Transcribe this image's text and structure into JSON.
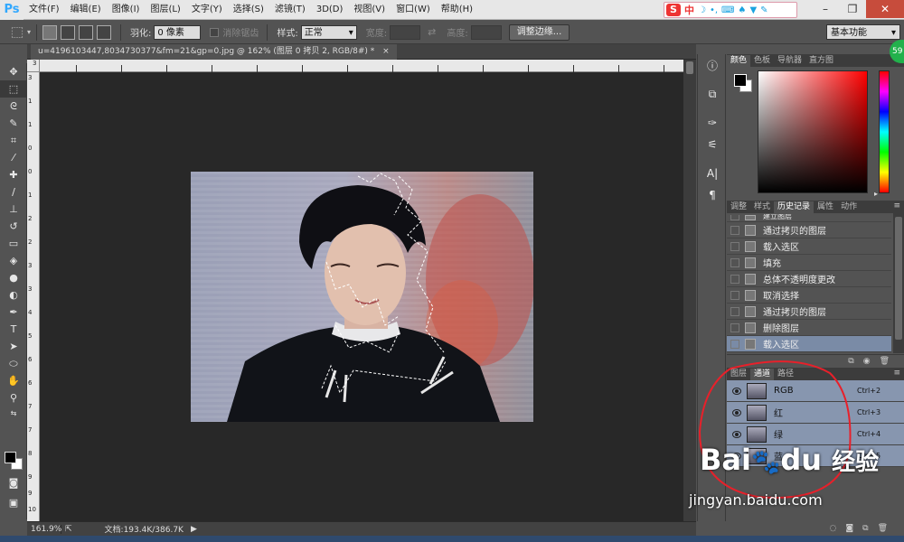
{
  "app": {
    "logo": "Ps"
  },
  "menu": [
    "文件(F)",
    "编辑(E)",
    "图像(I)",
    "图层(L)",
    "文字(Y)",
    "选择(S)",
    "滤镜(T)",
    "3D(D)",
    "视图(V)",
    "窗口(W)",
    "帮助(H)"
  ],
  "sogou": {
    "s": "S",
    "lang": "中"
  },
  "options": {
    "feather_label": "羽化:",
    "feather_value": "0 像素",
    "antialias_label": "消除锯齿",
    "style_label": "样式:",
    "style_value": "正常",
    "width_label": "宽度:",
    "height_label": "高度:",
    "refine_button": "调整边缘...",
    "workspace": "基本功能"
  },
  "document": {
    "tab_title": "u=4196103447,8034730377&fm=21&gp=0.jpg @ 162% (图层 0 拷贝 2, RGB/8#) *",
    "close": "×"
  },
  "rulers": {
    "top": [
      "3"
    ],
    "left": [
      "3",
      "1",
      "1",
      "0",
      "0",
      "1",
      "2",
      "2",
      "3",
      "3",
      "4",
      "5",
      "6",
      "6",
      "7",
      "7",
      "8",
      "9",
      "9",
      "10"
    ]
  },
  "status": {
    "zoom": "161.9%",
    "doc": "文档:193.4K/386.7K"
  },
  "badge": "59",
  "color_panel": {
    "tabs": [
      "颜色",
      "色板",
      "导航器",
      "直方图"
    ]
  },
  "history_panel": {
    "tabs": [
      "调整",
      "样式",
      "历史记录",
      "属性",
      "动作"
    ],
    "items": [
      "建立图层",
      "通过拷贝的图层",
      "载入选区",
      "填充",
      "总体不透明度更改",
      "取消选择",
      "通过拷贝的图层",
      "删除图层",
      "载入选区"
    ]
  },
  "channels_panel": {
    "tabs": [
      "图层",
      "通道",
      "路径"
    ],
    "channels": [
      {
        "name": "RGB",
        "shortcut": "Ctrl+2"
      },
      {
        "name": "红",
        "shortcut": "Ctrl+3"
      },
      {
        "name": "绿",
        "shortcut": "Ctrl+4"
      },
      {
        "name": "蓝",
        "shortcut": "Ctrl+5"
      }
    ]
  },
  "watermark": {
    "brand_a": "Bai",
    "brand_b": "du",
    "brand_c": "经验",
    "url": "jingyan.baidu.com"
  },
  "colors": {
    "accent": "#31a8ff",
    "selection": "#7a8ba6",
    "annotation": "#e8202a"
  }
}
